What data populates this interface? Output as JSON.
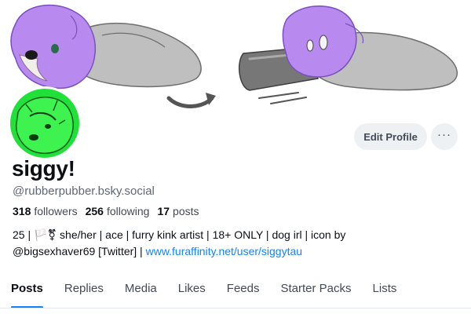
{
  "profile": {
    "display_name": "siggy!",
    "handle": "@rubberpubber.bsky.social",
    "banner_description": "banner-illustration",
    "avatar_description": "avatar-image"
  },
  "actions": {
    "edit_profile_label": "Edit Profile",
    "more_label": "···"
  },
  "stats": {
    "followers_count": "318",
    "followers_label": "followers",
    "following_count": "256",
    "following_label": "following",
    "posts_count": "17",
    "posts_label": "posts"
  },
  "bio": {
    "line1": "25 | 🏳️⚧ she/her | ace | furry kink artist | 18+ ONLY | dog irl | icon by",
    "line2_text": "@bigsexhaver69 [Twitter] | ",
    "link_text": "www.furaffinity.net/user/siggytau"
  },
  "tabs": [
    {
      "label": "Posts",
      "active": true
    },
    {
      "label": "Replies"
    },
    {
      "label": "Media"
    },
    {
      "label": "Likes"
    },
    {
      "label": "Feeds"
    },
    {
      "label": "Starter Packs"
    },
    {
      "label": "Lists"
    }
  ],
  "colors": {
    "accent": "#1083fe",
    "avatar_green": "#22e03a",
    "fur_purple": "#b889ee",
    "gray": "#a9a9a9"
  }
}
